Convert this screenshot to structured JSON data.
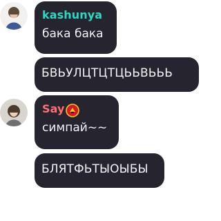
{
  "colors": {
    "bubble_bg": "#26252f",
    "text": "#f2f2f5",
    "kashunya_name": "#2bd9c2",
    "say_name": "#ff6f73",
    "badge_red": "#d71920",
    "badge_gold": "#f6c42d"
  },
  "messages": [
    {
      "author": "kashunya",
      "text": "бака бака",
      "avatar_icon": "avatar-kashunya"
    },
    {
      "author": "",
      "text": "БВЬУЛЦТЦТЦЬЬВЬЬЬ"
    },
    {
      "author": "Say",
      "text": "симпай~~",
      "badge_icon": "manchester-united-crest-icon",
      "avatar_icon": "avatar-say"
    },
    {
      "author": "",
      "text": "БЛЯТФЬТЫОЫБЫ"
    }
  ]
}
